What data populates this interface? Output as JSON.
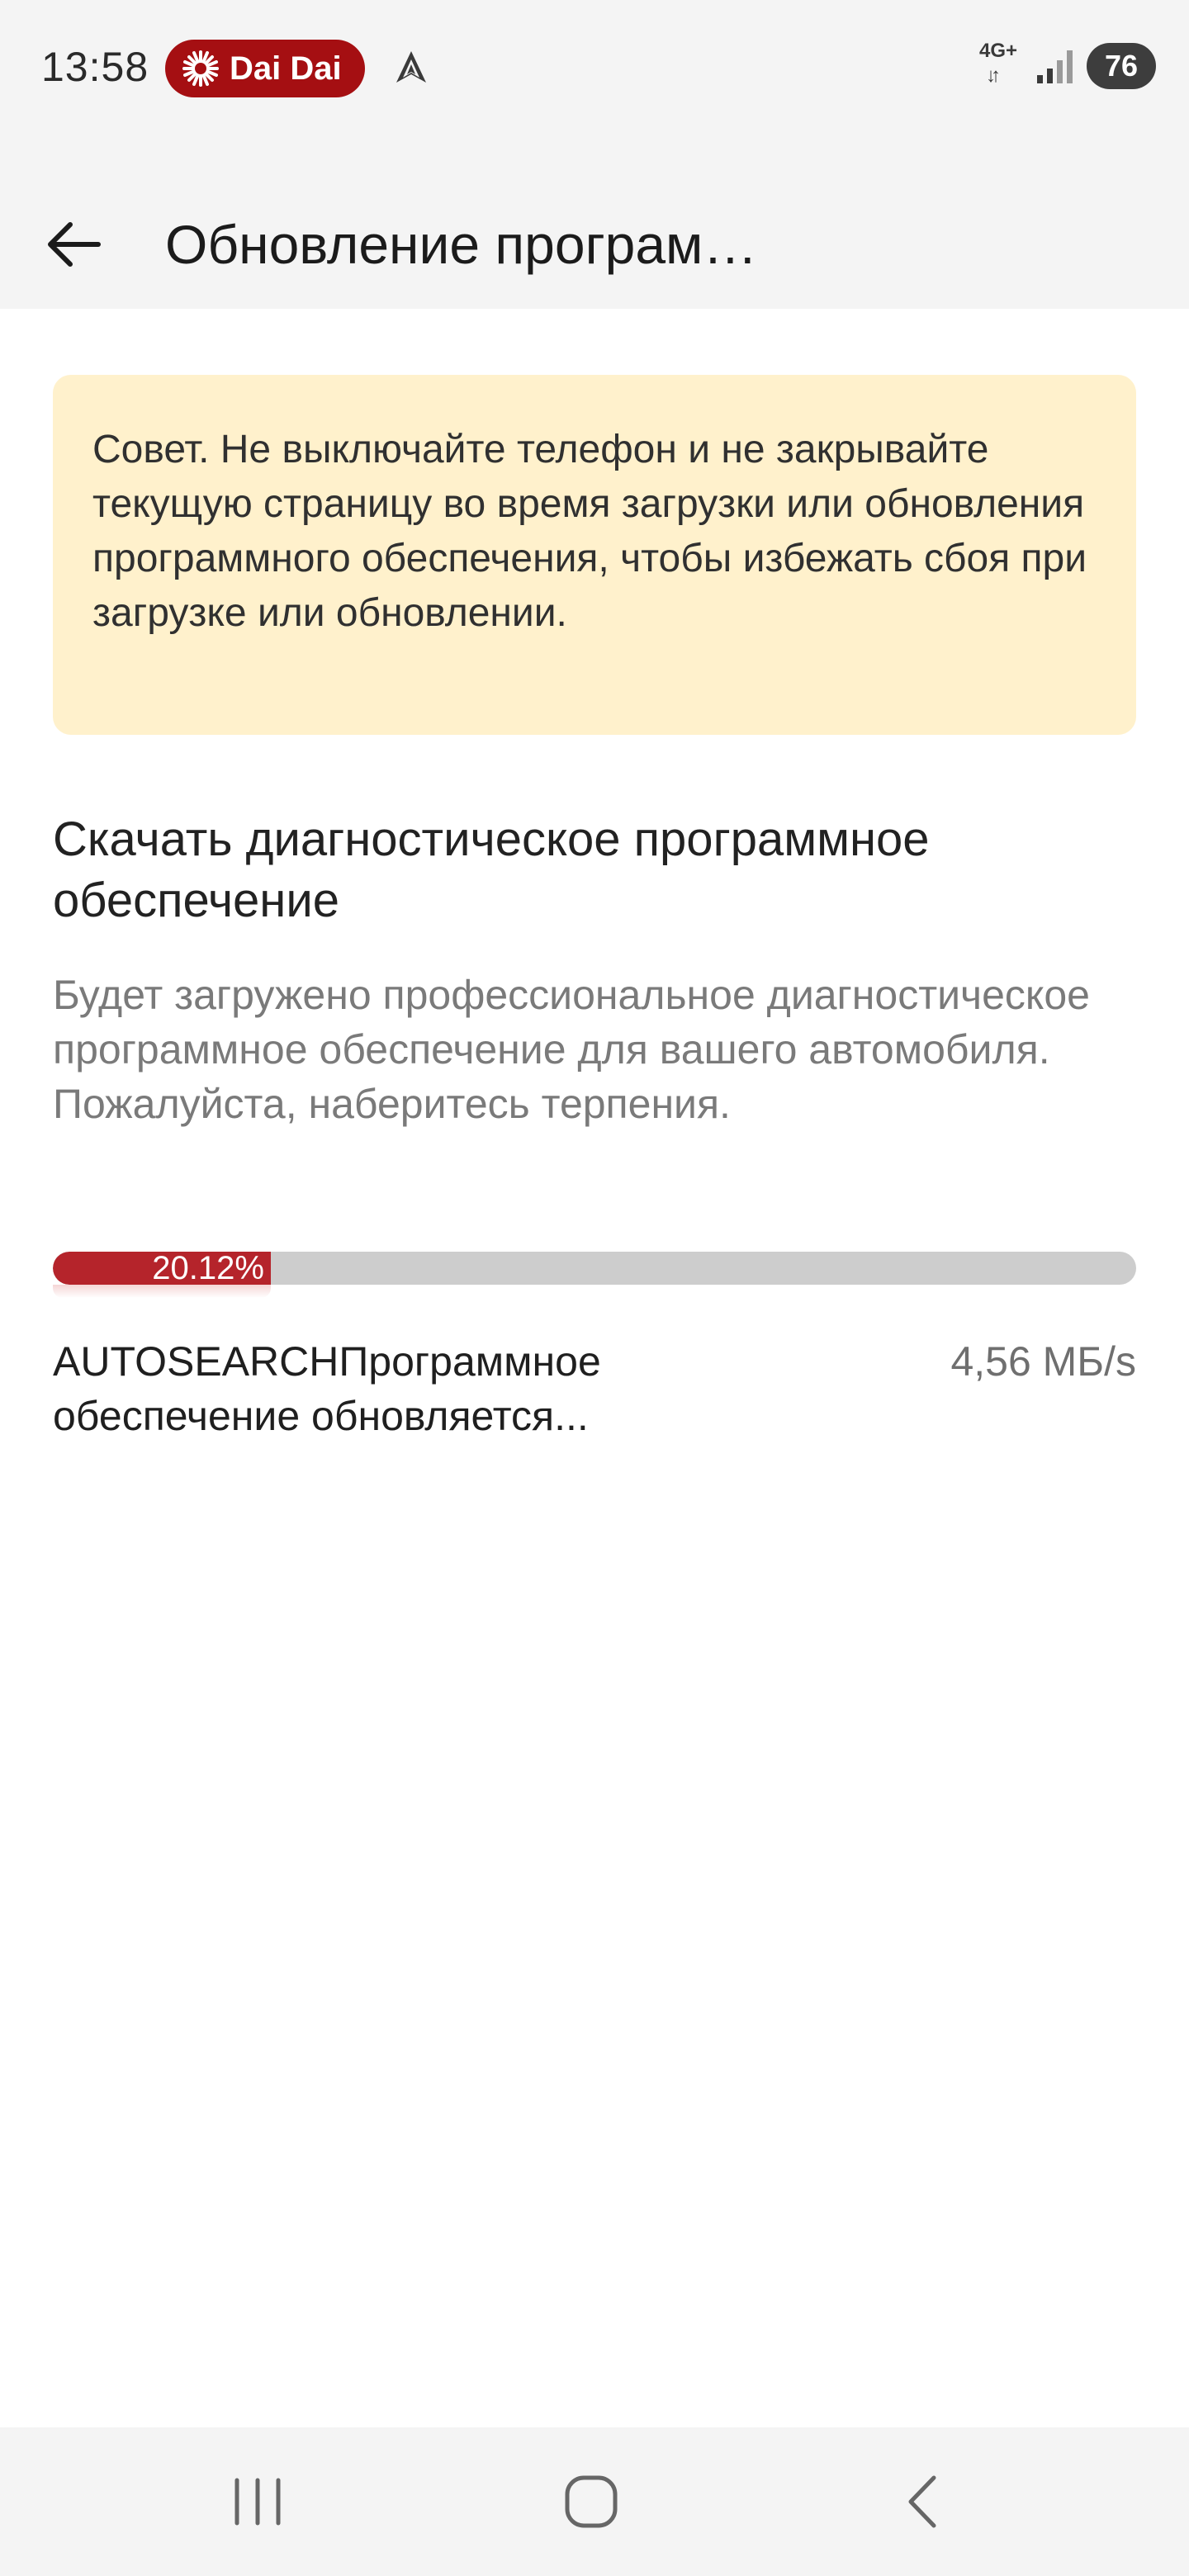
{
  "status_bar": {
    "time": "13:58",
    "notification_pill": "Dai Dai",
    "network_type": "4G+",
    "battery": "76",
    "colors": {
      "pill": "#a50f12",
      "battery": "#3d3d3d"
    }
  },
  "app_bar": {
    "title": "Обновление програм…",
    "back_icon": "arrow-left-icon"
  },
  "tip": {
    "text": "Совет. Не выключайте телефон и не закрывайте текущую страницу во время загрузки или обновления программного обеспечения, чтобы избежать сбоя при загрузке или обновлении.",
    "background": "#fff1cc"
  },
  "section": {
    "title": "Скачать диагностическое программное обеспечение",
    "description": "Будет загружено профессиональное диагностическое программное обеспечение для вашего автомобиля. Пожалуйста, наберитесь терпения."
  },
  "progress": {
    "percent": 20.12,
    "label": "20.12%",
    "fill_color": "#b5242b",
    "track_color": "#cdcdcd"
  },
  "download": {
    "status": "AUTOSEARCHПрограммное обеспечение обновляется...",
    "speed": "4,56 МБ/s"
  },
  "nav_bar": {
    "icons": [
      "recent-apps-icon",
      "home-icon",
      "back-icon"
    ]
  }
}
